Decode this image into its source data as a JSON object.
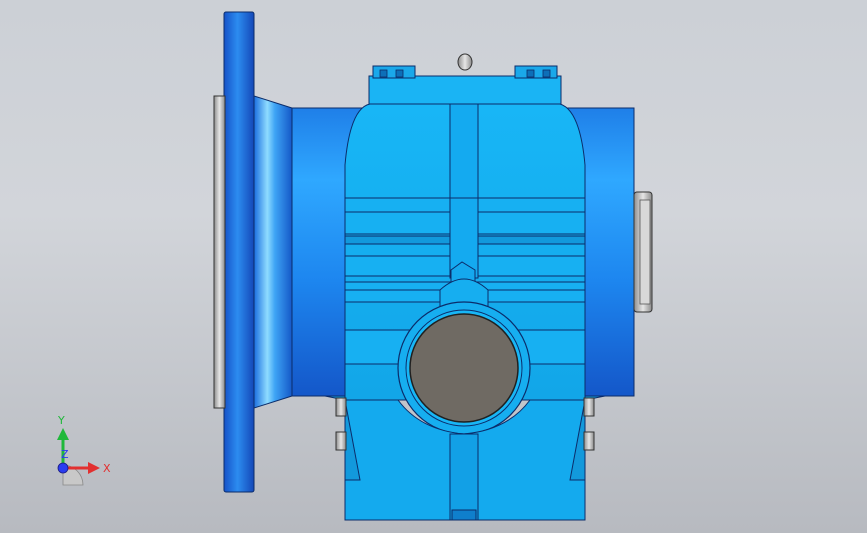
{
  "viewport": {
    "background_top": "#ccd0d6",
    "background_bottom": "#b7bac0"
  },
  "model": {
    "type": "worm gear reducer (front view)",
    "primary_color": "#16b0f0",
    "flange_color": "#1e78e6",
    "bore_color": "#6f6a63"
  },
  "triad": {
    "y_label": "Y",
    "x_label": "X",
    "z_label": "Z",
    "y_color": "#1fb83a",
    "x_color": "#e23030",
    "z_color": "#2a3cf0"
  }
}
